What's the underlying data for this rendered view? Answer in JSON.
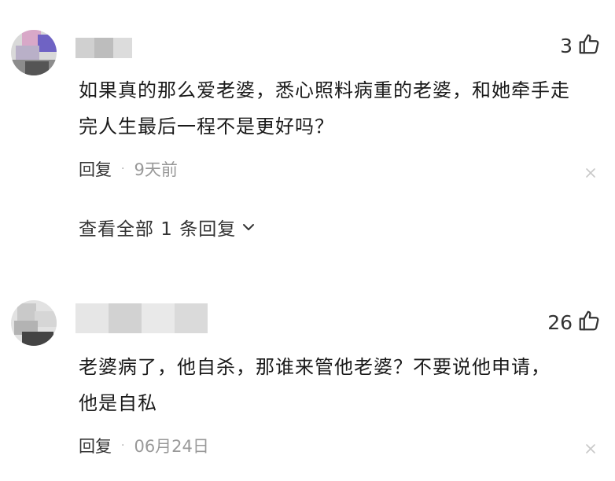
{
  "colors": {
    "text_primary": "#1a1a1a",
    "text_meta": "#999999",
    "icon": "#333333",
    "close_icon": "#c8c8c8"
  },
  "comments": [
    {
      "like_count": "3",
      "like_icon": "thumbs-up-icon",
      "text": "如果真的那么爱老婆，悉心照料病重的老婆，和她牵手走完人生最后一程不是更好吗？",
      "reply_label": "回复",
      "separator": "·",
      "time": "9天前",
      "view_replies_label": "查看全部 1 条回复",
      "close_icon": "close-icon"
    },
    {
      "like_count": "26",
      "like_icon": "thumbs-up-icon",
      "text": "老婆病了，他自杀，那谁来管他老婆？不要说他申请，他是自私",
      "reply_label": "回复",
      "separator": "·",
      "time": "06月24日",
      "close_icon": "close-icon"
    }
  ]
}
